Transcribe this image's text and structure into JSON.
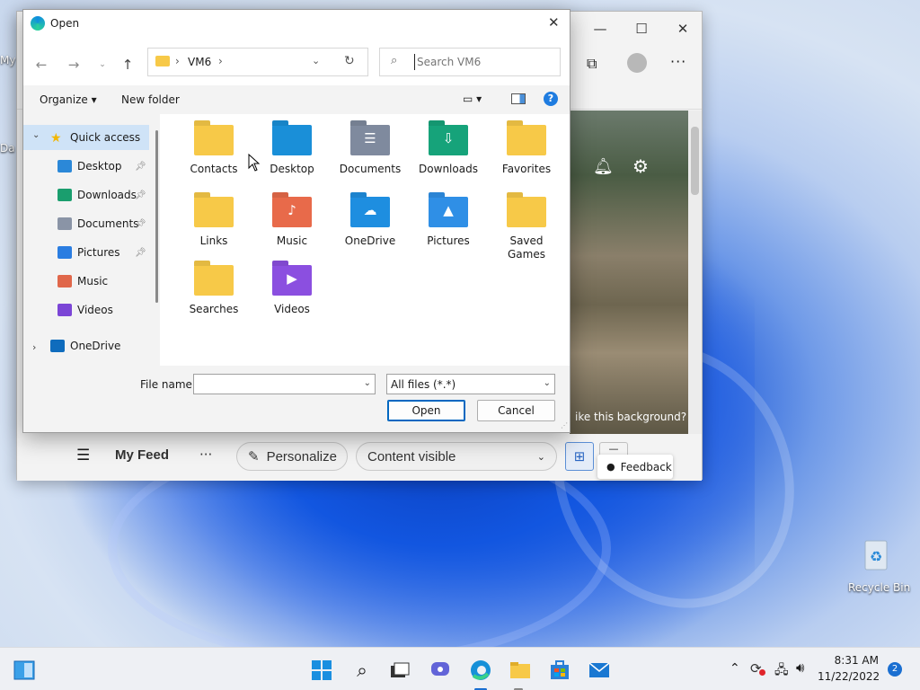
{
  "desktop": {
    "left_label_top": "My",
    "left_label_mid": "Da",
    "recycle_bin": "Recycle Bin"
  },
  "edge": {
    "feed_title": "My Feed",
    "more": "···",
    "personalize": "Personalize",
    "content_visible": "Content visible",
    "feedback": "Feedback",
    "photo_caption": "ike this background?",
    "bell_icon": "bell-icon",
    "settings_icon": "gear-icon"
  },
  "dialog": {
    "title": "Open",
    "close": "✕",
    "breadcrumb": [
      "VM6"
    ],
    "search_placeholder": "Search VM6",
    "organize": "Organize ▾",
    "new_folder": "New folder",
    "nav": [
      {
        "label": "Quick access",
        "icon": "star-icon",
        "color": "#f2b705",
        "level": 0,
        "expanded": true,
        "selected": true
      },
      {
        "label": "Desktop",
        "icon": "desktop-icon",
        "color": "#2b88d8",
        "level": 1,
        "pinned": true
      },
      {
        "label": "Downloads",
        "icon": "download-icon",
        "color": "#1a9e6e",
        "level": 1,
        "pinned": true
      },
      {
        "label": "Documents",
        "icon": "document-icon",
        "color": "#8a94a6",
        "level": 1,
        "pinned": true
      },
      {
        "label": "Pictures",
        "icon": "picture-icon",
        "color": "#2a7de1",
        "level": 1,
        "pinned": true
      },
      {
        "label": "Music",
        "icon": "music-icon",
        "color": "#e0674a",
        "level": 1,
        "pinned": false
      },
      {
        "label": "Videos",
        "icon": "video-icon",
        "color": "#7b45d6",
        "level": 1,
        "pinned": false
      },
      {
        "label": "OneDrive",
        "icon": "cloud-icon",
        "color": "#0f6cbd",
        "level": 0,
        "expanded": false
      }
    ],
    "folders": [
      {
        "label": "Contacts",
        "icon": "contacts-folder-icon",
        "color": "#f7c948",
        "glyph": ""
      },
      {
        "label": "Desktop",
        "icon": "desktop-folder-icon",
        "color": "#1a8fd8",
        "glyph": ""
      },
      {
        "label": "Documents",
        "icon": "documents-folder-icon",
        "color": "#7f8a9e",
        "glyph": "☰"
      },
      {
        "label": "Downloads",
        "icon": "downloads-folder-icon",
        "color": "#16a37a",
        "glyph": "⇩"
      },
      {
        "label": "Favorites",
        "icon": "favorites-folder-icon",
        "color": "#f7c948",
        "glyph": ""
      },
      {
        "label": "Links",
        "icon": "links-folder-icon",
        "color": "#f7c948",
        "glyph": ""
      },
      {
        "label": "Music",
        "icon": "music-folder-icon",
        "color": "#e86a4a",
        "glyph": "♪"
      },
      {
        "label": "OneDrive",
        "icon": "onedrive-folder-icon",
        "color": "#1e8ee0",
        "glyph": "☁"
      },
      {
        "label": "Pictures",
        "icon": "pictures-folder-icon",
        "color": "#2f8fe6",
        "glyph": "▲"
      },
      {
        "label": "Saved\nGames",
        "icon": "saved-games-folder-icon",
        "color": "#f7c948",
        "glyph": ""
      },
      {
        "label": "Searches",
        "icon": "searches-folder-icon",
        "color": "#f7c948",
        "glyph": ""
      },
      {
        "label": "Videos",
        "icon": "videos-folder-icon",
        "color": "#8b4fe0",
        "glyph": "▶"
      }
    ],
    "file_name_label": "File name:",
    "file_name_value": "",
    "file_type": "All files (*.*)",
    "open_button": "Open",
    "cancel_button": "Cancel"
  },
  "taskbar": {
    "time": "8:31 AM",
    "date": "11/22/2022",
    "notifications": "2"
  }
}
